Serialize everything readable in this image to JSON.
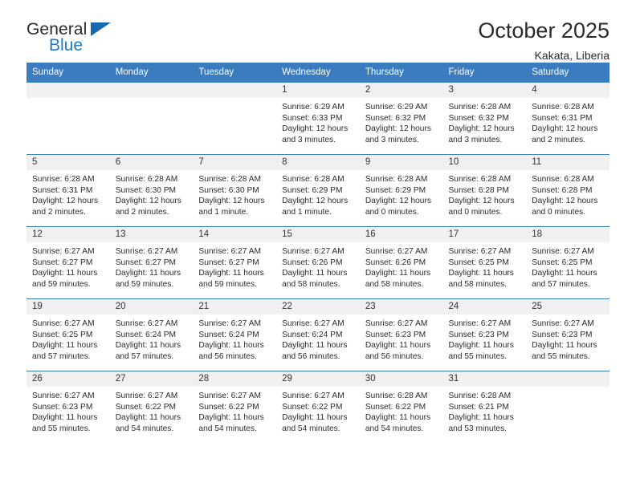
{
  "brand": {
    "name_part1": "General",
    "name_part2": "Blue",
    "accent_color": "#1668b3"
  },
  "header": {
    "title": "October 2025",
    "location": "Kakata, Liberia"
  },
  "theme": {
    "header_bg": "#3a7cbe",
    "daynum_bg": "#f0f0f0",
    "text": "#2b2b2b"
  },
  "weekday_headers": [
    "Sunday",
    "Monday",
    "Tuesday",
    "Wednesday",
    "Thursday",
    "Friday",
    "Saturday"
  ],
  "labels": {
    "sunrise_prefix": "Sunrise:",
    "sunset_prefix": "Sunset:",
    "daylight_prefix": "Daylight:"
  },
  "weeks": [
    [
      {
        "day": "",
        "blank": true,
        "sunrise": "",
        "sunset": "",
        "daylight_line1": "",
        "daylight_line2": ""
      },
      {
        "day": "",
        "blank": true,
        "sunrise": "",
        "sunset": "",
        "daylight_line1": "",
        "daylight_line2": ""
      },
      {
        "day": "",
        "blank": true,
        "sunrise": "",
        "sunset": "",
        "daylight_line1": "",
        "daylight_line2": ""
      },
      {
        "day": "1",
        "blank": false,
        "sunrise": "Sunrise: 6:29 AM",
        "sunset": "Sunset: 6:33 PM",
        "daylight_line1": "Daylight: 12 hours",
        "daylight_line2": "and 3 minutes."
      },
      {
        "day": "2",
        "blank": false,
        "sunrise": "Sunrise: 6:29 AM",
        "sunset": "Sunset: 6:32 PM",
        "daylight_line1": "Daylight: 12 hours",
        "daylight_line2": "and 3 minutes."
      },
      {
        "day": "3",
        "blank": false,
        "sunrise": "Sunrise: 6:28 AM",
        "sunset": "Sunset: 6:32 PM",
        "daylight_line1": "Daylight: 12 hours",
        "daylight_line2": "and 3 minutes."
      },
      {
        "day": "4",
        "blank": false,
        "sunrise": "Sunrise: 6:28 AM",
        "sunset": "Sunset: 6:31 PM",
        "daylight_line1": "Daylight: 12 hours",
        "daylight_line2": "and 2 minutes."
      }
    ],
    [
      {
        "day": "5",
        "blank": false,
        "sunrise": "Sunrise: 6:28 AM",
        "sunset": "Sunset: 6:31 PM",
        "daylight_line1": "Daylight: 12 hours",
        "daylight_line2": "and 2 minutes."
      },
      {
        "day": "6",
        "blank": false,
        "sunrise": "Sunrise: 6:28 AM",
        "sunset": "Sunset: 6:30 PM",
        "daylight_line1": "Daylight: 12 hours",
        "daylight_line2": "and 2 minutes."
      },
      {
        "day": "7",
        "blank": false,
        "sunrise": "Sunrise: 6:28 AM",
        "sunset": "Sunset: 6:30 PM",
        "daylight_line1": "Daylight: 12 hours",
        "daylight_line2": "and 1 minute."
      },
      {
        "day": "8",
        "blank": false,
        "sunrise": "Sunrise: 6:28 AM",
        "sunset": "Sunset: 6:29 PM",
        "daylight_line1": "Daylight: 12 hours",
        "daylight_line2": "and 1 minute."
      },
      {
        "day": "9",
        "blank": false,
        "sunrise": "Sunrise: 6:28 AM",
        "sunset": "Sunset: 6:29 PM",
        "daylight_line1": "Daylight: 12 hours",
        "daylight_line2": "and 0 minutes."
      },
      {
        "day": "10",
        "blank": false,
        "sunrise": "Sunrise: 6:28 AM",
        "sunset": "Sunset: 6:28 PM",
        "daylight_line1": "Daylight: 12 hours",
        "daylight_line2": "and 0 minutes."
      },
      {
        "day": "11",
        "blank": false,
        "sunrise": "Sunrise: 6:28 AM",
        "sunset": "Sunset: 6:28 PM",
        "daylight_line1": "Daylight: 12 hours",
        "daylight_line2": "and 0 minutes."
      }
    ],
    [
      {
        "day": "12",
        "blank": false,
        "sunrise": "Sunrise: 6:27 AM",
        "sunset": "Sunset: 6:27 PM",
        "daylight_line1": "Daylight: 11 hours",
        "daylight_line2": "and 59 minutes."
      },
      {
        "day": "13",
        "blank": false,
        "sunrise": "Sunrise: 6:27 AM",
        "sunset": "Sunset: 6:27 PM",
        "daylight_line1": "Daylight: 11 hours",
        "daylight_line2": "and 59 minutes."
      },
      {
        "day": "14",
        "blank": false,
        "sunrise": "Sunrise: 6:27 AM",
        "sunset": "Sunset: 6:27 PM",
        "daylight_line1": "Daylight: 11 hours",
        "daylight_line2": "and 59 minutes."
      },
      {
        "day": "15",
        "blank": false,
        "sunrise": "Sunrise: 6:27 AM",
        "sunset": "Sunset: 6:26 PM",
        "daylight_line1": "Daylight: 11 hours",
        "daylight_line2": "and 58 minutes."
      },
      {
        "day": "16",
        "blank": false,
        "sunrise": "Sunrise: 6:27 AM",
        "sunset": "Sunset: 6:26 PM",
        "daylight_line1": "Daylight: 11 hours",
        "daylight_line2": "and 58 minutes."
      },
      {
        "day": "17",
        "blank": false,
        "sunrise": "Sunrise: 6:27 AM",
        "sunset": "Sunset: 6:25 PM",
        "daylight_line1": "Daylight: 11 hours",
        "daylight_line2": "and 58 minutes."
      },
      {
        "day": "18",
        "blank": false,
        "sunrise": "Sunrise: 6:27 AM",
        "sunset": "Sunset: 6:25 PM",
        "daylight_line1": "Daylight: 11 hours",
        "daylight_line2": "and 57 minutes."
      }
    ],
    [
      {
        "day": "19",
        "blank": false,
        "sunrise": "Sunrise: 6:27 AM",
        "sunset": "Sunset: 6:25 PM",
        "daylight_line1": "Daylight: 11 hours",
        "daylight_line2": "and 57 minutes."
      },
      {
        "day": "20",
        "blank": false,
        "sunrise": "Sunrise: 6:27 AM",
        "sunset": "Sunset: 6:24 PM",
        "daylight_line1": "Daylight: 11 hours",
        "daylight_line2": "and 57 minutes."
      },
      {
        "day": "21",
        "blank": false,
        "sunrise": "Sunrise: 6:27 AM",
        "sunset": "Sunset: 6:24 PM",
        "daylight_line1": "Daylight: 11 hours",
        "daylight_line2": "and 56 minutes."
      },
      {
        "day": "22",
        "blank": false,
        "sunrise": "Sunrise: 6:27 AM",
        "sunset": "Sunset: 6:24 PM",
        "daylight_line1": "Daylight: 11 hours",
        "daylight_line2": "and 56 minutes."
      },
      {
        "day": "23",
        "blank": false,
        "sunrise": "Sunrise: 6:27 AM",
        "sunset": "Sunset: 6:23 PM",
        "daylight_line1": "Daylight: 11 hours",
        "daylight_line2": "and 56 minutes."
      },
      {
        "day": "24",
        "blank": false,
        "sunrise": "Sunrise: 6:27 AM",
        "sunset": "Sunset: 6:23 PM",
        "daylight_line1": "Daylight: 11 hours",
        "daylight_line2": "and 55 minutes."
      },
      {
        "day": "25",
        "blank": false,
        "sunrise": "Sunrise: 6:27 AM",
        "sunset": "Sunset: 6:23 PM",
        "daylight_line1": "Daylight: 11 hours",
        "daylight_line2": "and 55 minutes."
      }
    ],
    [
      {
        "day": "26",
        "blank": false,
        "sunrise": "Sunrise: 6:27 AM",
        "sunset": "Sunset: 6:23 PM",
        "daylight_line1": "Daylight: 11 hours",
        "daylight_line2": "and 55 minutes."
      },
      {
        "day": "27",
        "blank": false,
        "sunrise": "Sunrise: 6:27 AM",
        "sunset": "Sunset: 6:22 PM",
        "daylight_line1": "Daylight: 11 hours",
        "daylight_line2": "and 54 minutes."
      },
      {
        "day": "28",
        "blank": false,
        "sunrise": "Sunrise: 6:27 AM",
        "sunset": "Sunset: 6:22 PM",
        "daylight_line1": "Daylight: 11 hours",
        "daylight_line2": "and 54 minutes."
      },
      {
        "day": "29",
        "blank": false,
        "sunrise": "Sunrise: 6:27 AM",
        "sunset": "Sunset: 6:22 PM",
        "daylight_line1": "Daylight: 11 hours",
        "daylight_line2": "and 54 minutes."
      },
      {
        "day": "30",
        "blank": false,
        "sunrise": "Sunrise: 6:28 AM",
        "sunset": "Sunset: 6:22 PM",
        "daylight_line1": "Daylight: 11 hours",
        "daylight_line2": "and 54 minutes."
      },
      {
        "day": "31",
        "blank": false,
        "sunrise": "Sunrise: 6:28 AM",
        "sunset": "Sunset: 6:21 PM",
        "daylight_line1": "Daylight: 11 hours",
        "daylight_line2": "and 53 minutes."
      },
      {
        "day": "",
        "blank": true,
        "sunrise": "",
        "sunset": "",
        "daylight_line1": "",
        "daylight_line2": ""
      }
    ]
  ]
}
